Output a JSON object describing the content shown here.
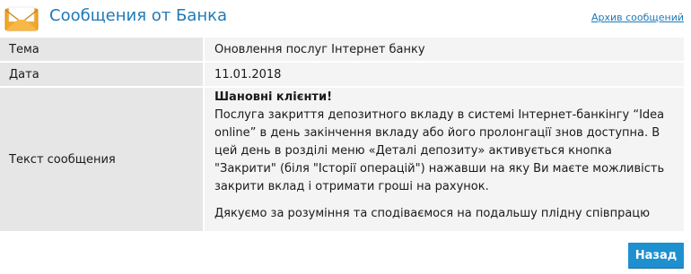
{
  "header": {
    "title": "Сообщения от Банка",
    "archive_link": "Архив сообщений",
    "icon": "envelope-icon"
  },
  "message": {
    "rows": [
      {
        "label": "Тема",
        "value": "Оновлення послуг Інтернет банку"
      },
      {
        "label": "Дата",
        "value": "11.01.2018"
      },
      {
        "label": "Текст сообщения"
      }
    ],
    "greeting": "Шановні клієнти!",
    "body": "Послуга закриття депозитного вкладу в системі Інтернет-банкінгу “Idea online” в день закінчення вкладу або його пролонгації знов доступна. В цей день в розділі меню «Деталі депозиту» активується кнопка \"Закрити\" (біля \"Історії операцій\") нажавши на яку Ви маєте можливість закрити вклад і отримати гроші на рахунок.",
    "thanks": "Дякуємо за розуміння та сподіваємося на подальшу плідну співпрацю"
  },
  "actions": {
    "back_label": "Назад"
  },
  "colors": {
    "accent": "#1f79b8",
    "button": "#1e90d0",
    "label_bg": "#e6e6e6",
    "value_bg": "#f4f4f4",
    "envelope": "#f3a72a"
  }
}
